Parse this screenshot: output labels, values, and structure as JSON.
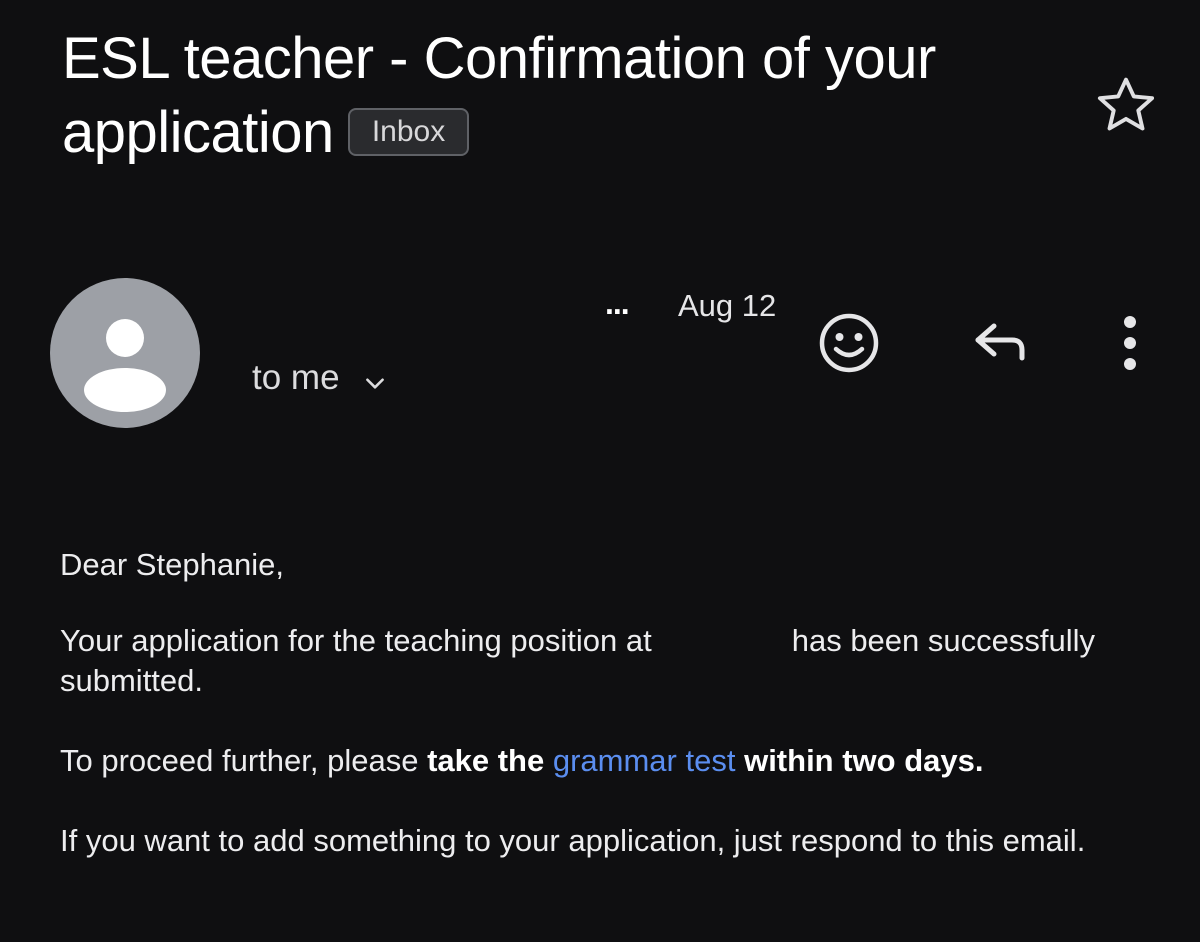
{
  "subject": {
    "title": "ESL teacher - Confirmation of your application",
    "label_badge": "Inbox"
  },
  "header_icons": {
    "star": "star-outline-icon"
  },
  "message_header": {
    "sender_ellipsis": "...",
    "date": "Aug 12",
    "recipient": "to me",
    "actions": {
      "emoji": "emoji-reaction-icon",
      "reply": "reply-icon",
      "more": "more-vert-icon"
    }
  },
  "body": {
    "greeting": "Dear Stephanie,",
    "para1_before": "Your application for the teaching position at",
    "para1_after": "has been successfully submitted.",
    "para2_start": "To proceed further, please ",
    "para2_bold1": "take the ",
    "para2_link": "grammar test",
    "para2_bold2": " within two days.",
    "para3": "If you want to add something to your application, just respond to this email."
  },
  "colors": {
    "background": "#0f0f11",
    "link": "#5b8ef0",
    "avatar": "#9da0a6"
  }
}
